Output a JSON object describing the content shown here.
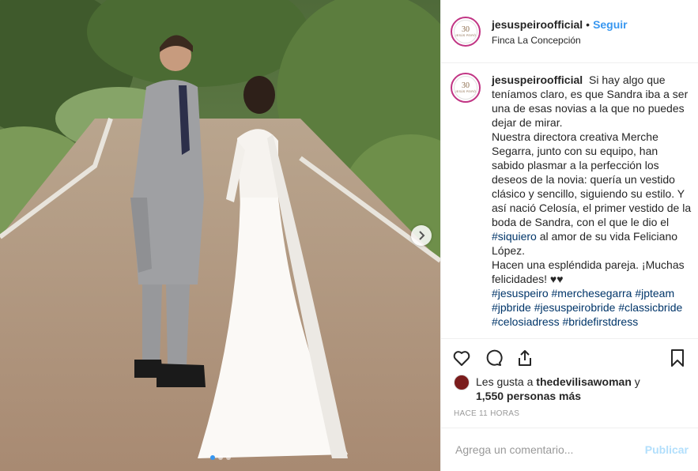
{
  "post": {
    "image_alt": "",
    "carousel_dots": 3,
    "carousel_active": 1
  },
  "header": {
    "avatar_logo_number": "30",
    "avatar_logo_text": "JESÚS PEIRÓ",
    "username": "jesuspeiroofficial",
    "separator": "•",
    "follow_label": "Seguir",
    "location": "Finca La Concepción"
  },
  "caption": {
    "username": "jesuspeiroofficial",
    "text_1": "Si hay algo que teníamos claro, es que Sandra iba a ser una de esas novias a la que no puedes dejar de mirar.",
    "text_2": "Nuestra directora creativa Merche Segarra, junto con su equipo, han sabido plasmar a la perfección los deseos de la novia: quería un vestido clásico y sencillo, siguiendo su estilo. Y así nació Celosía, el primer vestido de la boda de Sandra, con el que le dio el",
    "hashtag_inline": "#siquiero",
    "text_3": " al amor de su vida Feliciano López.",
    "text_4": "Hacen una espléndida pareja. ¡Muchas felicidades! ♥♥",
    "hashtags": [
      "#jesuspeiro",
      "#merchesegarra",
      "#jpteam",
      "#jpbride",
      "#jesuspeirobride",
      "#classicbride",
      "#celosiadress",
      "#bridefirstdress"
    ]
  },
  "actions": {
    "like_icon": "heart-icon",
    "comment_icon": "comment-icon",
    "share_icon": "share-icon",
    "save_icon": "bookmark-icon"
  },
  "likes": {
    "prefix": "Les gusta a",
    "user": "thedevilisawoman",
    "connector": "y",
    "others": "1,550 personas más"
  },
  "timestamp": "Hace 11 horas",
  "comment": {
    "placeholder": "Agrega un comentario...",
    "publish_label": "Publicar"
  },
  "colors": {
    "link_blue": "#3897f0",
    "hashtag": "#003569",
    "publish_disabled": "#b2dffc"
  }
}
